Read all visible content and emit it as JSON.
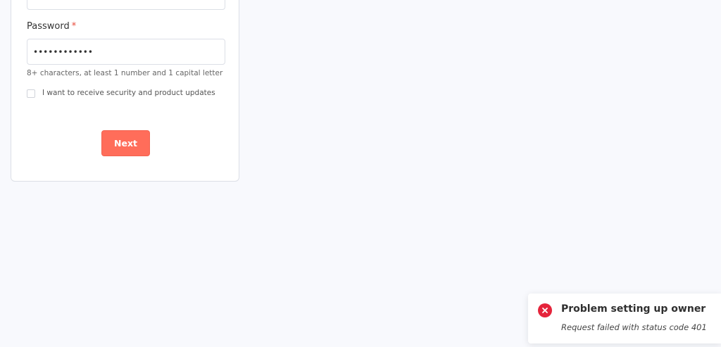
{
  "form": {
    "password_label": "Password",
    "required_mark": "*",
    "password_value": "••••••••••••",
    "password_hint": "8+ characters, at least 1 number and 1 capital letter",
    "updates_checkbox_label": "I want to receive security and product updates",
    "updates_checked": false,
    "next_label": "Next"
  },
  "toast": {
    "title": "Problem setting up owner",
    "message": "Request failed with status code 401",
    "icon": "error-x-icon"
  },
  "colors": {
    "primary": "#ff6d5a",
    "error": "#e5243b",
    "background": "#f8f9fd"
  }
}
